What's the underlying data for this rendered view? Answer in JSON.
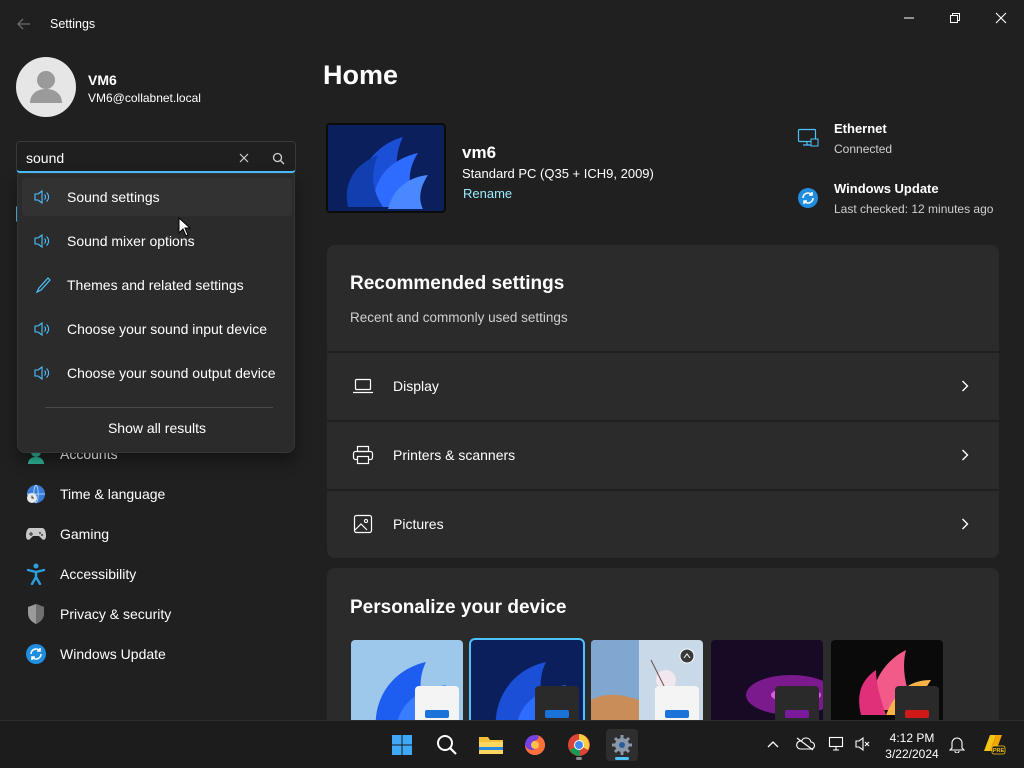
{
  "window": {
    "title": "Settings"
  },
  "user": {
    "name": "VM6",
    "email": "VM6@collabnet.local"
  },
  "search": {
    "value": "sound",
    "results": [
      {
        "label": "Sound settings",
        "icon": "speaker-icon"
      },
      {
        "label": "Sound mixer options",
        "icon": "speaker-icon"
      },
      {
        "label": "Themes and related settings",
        "icon": "brush-icon"
      },
      {
        "label": "Choose your sound input device",
        "icon": "speaker-icon"
      },
      {
        "label": "Choose your sound output device",
        "icon": "speaker-icon"
      }
    ],
    "show_all": "Show all results"
  },
  "sidebar": {
    "items": [
      {
        "label": "Accounts",
        "icon": "accounts-icon"
      },
      {
        "label": "Time & language",
        "icon": "globe-clock-icon"
      },
      {
        "label": "Gaming",
        "icon": "gamepad-icon"
      },
      {
        "label": "Accessibility",
        "icon": "accessibility-icon"
      },
      {
        "label": "Privacy & security",
        "icon": "shield-icon"
      },
      {
        "label": "Windows Update",
        "icon": "windows-update-icon"
      }
    ]
  },
  "main": {
    "title": "Home",
    "pc": {
      "name": "vm6",
      "model": "Standard PC (Q35 + ICH9, 2009)",
      "rename": "Rename"
    },
    "status": [
      {
        "title": "Ethernet",
        "sub": "Connected",
        "icon": "ethernet-icon"
      },
      {
        "title": "Windows Update",
        "sub": "Last checked: 12 minutes ago",
        "icon": "sync-icon"
      }
    ],
    "recommended": {
      "title": "Recommended settings",
      "subtitle": "Recent and commonly used settings",
      "rows": [
        {
          "label": "Display",
          "icon": "laptop-icon"
        },
        {
          "label": "Printers & scanners",
          "icon": "printer-icon"
        },
        {
          "label": "Pictures",
          "icon": "picture-icon"
        }
      ]
    },
    "personalize": {
      "title": "Personalize your device"
    }
  },
  "taskbar": {
    "time": "4:12 PM",
    "date": "3/22/2024"
  },
  "colors": {
    "accent": "#4cc2ff",
    "link": "#99ebff",
    "background": "#202020",
    "card": "#2b2b2b"
  }
}
